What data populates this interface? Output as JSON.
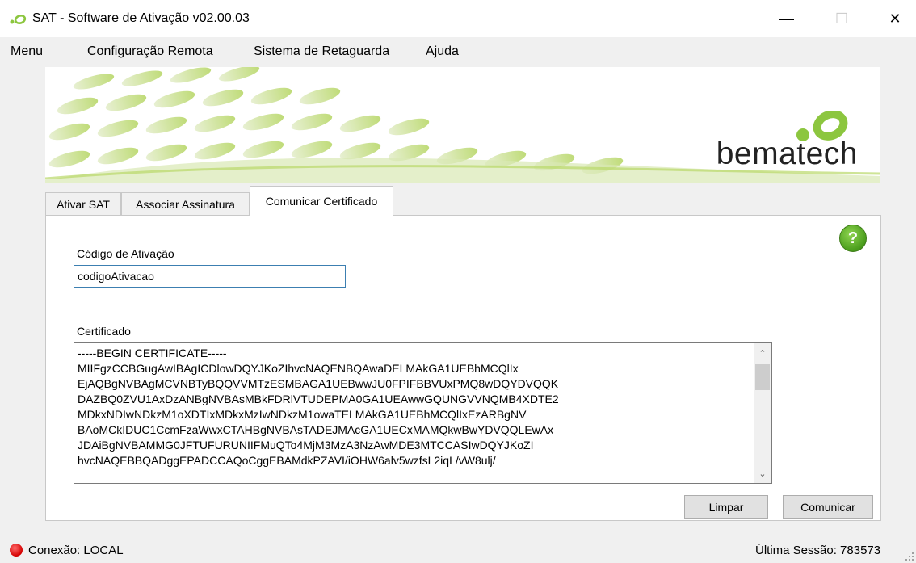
{
  "window": {
    "title": "SAT - Software de Ativação v02.00.03",
    "minimize_symbol": "—",
    "maximize_symbol": "☐",
    "close_symbol": "✕"
  },
  "menu": {
    "items": [
      "Menu",
      "Configuração Remota",
      "Sistema de Retaguarda",
      "Ajuda"
    ]
  },
  "banner": {
    "brand": "bematech",
    "accent_color": "#8cc63f"
  },
  "tabs": [
    {
      "label": "Ativar SAT",
      "active": false
    },
    {
      "label": "Associar Assinatura",
      "active": false
    },
    {
      "label": "Comunicar Certificado",
      "active": true
    }
  ],
  "form": {
    "help_label": "?",
    "codigo_label": "Código de Ativação",
    "codigo_value": "codigoAtivacao",
    "certificado_label": "Certificado",
    "certificado_text": "-----BEGIN CERTIFICATE-----\nMIIFgzCCBGugAwIBAgICDlowDQYJKoZIhvcNAQENBQAwaDELMAkGA1UEBhMCQlIx\nEjAQBgNVBAgMCVNBTyBQQVVMTzESMBAGA1UEBwwJU0FPIFBBVUxPMQ8wDQYDVQQK\nDAZBQ0ZVU1AxDzANBgNVBAsMBkFDRlVTUDEPMA0GA1UEAwwGQUNGVVNQMB4XDTE2\nMDkxNDIwNDkzM1oXDTIxMDkxMzIwNDkzM1owaTELMAkGA1UEBhMCQlIxEzARBgNV\nBAoMCkIDUC1CcmFzaWwxCTAHBgNVBAsTADEJMAcGA1UECxMAMQkwBwYDVQQLEwAx\nJDAiBgNVBAMMG0JFTUFURUNIIFMuQTo4MjM3MzA3NzAwMDE3MTCCASIwDQYJKoZI\nhvcNAQEBBQADggEPADCCAQoCggEBAMdkPZAVI/iOHW6alv5wzfsL2iqL/vW8ulj/",
    "limpar_label": "Limpar",
    "comunicar_label": "Comunicar",
    "scroll_up": "⌃",
    "scroll_down": "⌄"
  },
  "status": {
    "connection": "Conexão: LOCAL",
    "connection_color": "#d40000",
    "session": "Última Sessão: 783573"
  }
}
